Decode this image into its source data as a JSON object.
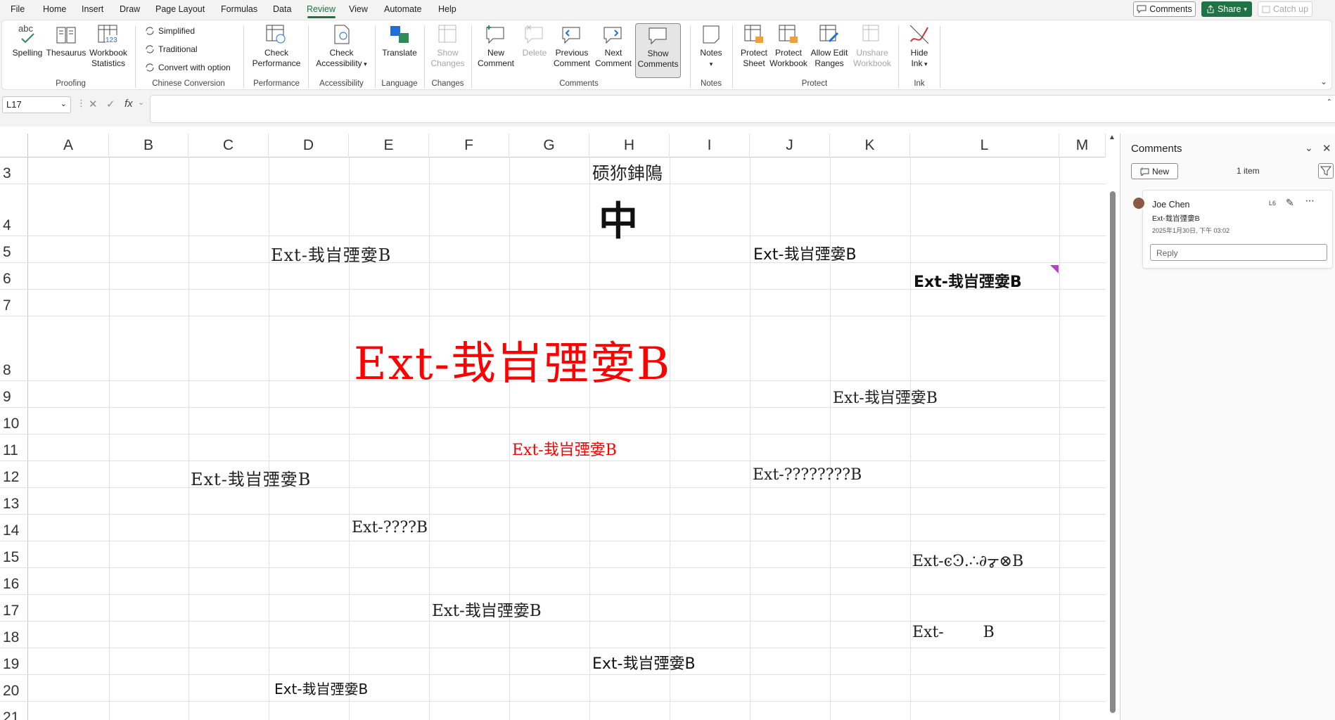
{
  "menubar": {
    "items": [
      "File",
      "Home",
      "Insert",
      "Draw",
      "Page Layout",
      "Formulas",
      "Data",
      "Review",
      "View",
      "Automate",
      "Help"
    ],
    "active": "Review",
    "comments_button": "Comments",
    "share_button": "Share",
    "catchup_button": "Catch up"
  },
  "ribbon": {
    "proofing": {
      "spelling": "Spelling",
      "thesaurus": "Thesaurus",
      "workbook_statistics_1": "Workbook",
      "workbook_statistics_2": "Statistics",
      "group": "Proofing",
      "abc": "abc",
      "num": "123"
    },
    "chinese": {
      "simplified": "Simplified",
      "traditional": "Traditional",
      "convert": "Convert with option",
      "group": "Chinese Conversion"
    },
    "performance": {
      "check_1": "Check",
      "check_2": "Performance",
      "group": "Performance"
    },
    "accessibility": {
      "check_1": "Check",
      "check_2": "Accessibility",
      "group": "Accessibility"
    },
    "language": {
      "translate": "Translate",
      "group": "Language"
    },
    "changes": {
      "show_1": "Show",
      "show_2": "Changes",
      "group": "Changes"
    },
    "comments": {
      "new_1": "New",
      "new_2": "Comment",
      "delete": "Delete",
      "previous_1": "Previous",
      "previous_2": "Comment",
      "next_1": "Next",
      "next_2": "Comment",
      "show_1": "Show",
      "show_2": "Comments",
      "group": "Comments"
    },
    "notes": {
      "notes": "Notes",
      "group": "Notes"
    },
    "protect": {
      "sheet_1": "Protect",
      "sheet_2": "Sheet",
      "workbook_1": "Protect",
      "workbook_2": "Workbook",
      "ranges_1": "Allow Edit",
      "ranges_2": "Ranges",
      "unshare_1": "Unshare",
      "unshare_2": "Workbook",
      "group": "Protect"
    },
    "ink": {
      "hide_1": "Hide",
      "hide_2": "Ink",
      "group": "Ink"
    }
  },
  "formula_bar": {
    "name_box": "L17",
    "fx": "fx",
    "value": ""
  },
  "grid": {
    "columns": [
      "A",
      "B",
      "C",
      "D",
      "E",
      "F",
      "G",
      "H",
      "I",
      "J",
      "K",
      "L",
      "M"
    ],
    "rows": [
      "3",
      "4",
      "5",
      "6",
      "7",
      "8",
      "9",
      "10",
      "11",
      "12",
      "13",
      "14",
      "15",
      "16",
      "17",
      "18",
      "19",
      "20",
      "21"
    ],
    "cells": {
      "H3": "䂵狝鋛隝",
      "H4": "中",
      "D5": "Ext-㘽㞱㢾㛳B",
      "J5": "Ext-㘽㞱㢾㛳B",
      "L6": "Ext-㘽㞱㢾㛳B",
      "E8": "Ext-㘽㞱㢾㛳B",
      "K9": "Ext-㘽㞱㢾㛳B",
      "G11": "Ext-㘽㞱㢾㛳B",
      "C12": "Ext-㘽㞱㢾㛳B",
      "J12": "Ext-????????B",
      "E14": "Ext-????B",
      "L15": "Ext-ͼϿ.∴∂ᡒ⊗B",
      "F17": "Ext-㘽㞱㢾㛳B",
      "L18": "Ext-        B",
      "H19": "Ext-㘽㞱㢾㛳B",
      "D20": "Ext-㘽㞱㢾㛳B"
    },
    "red_color": "#ff0000",
    "comment_marker_color": "#b146c2"
  },
  "comments_pane": {
    "title": "Comments",
    "new_button": "New",
    "count": "1 item",
    "comment": {
      "author": "Joe Chen",
      "cell": "L6",
      "text": "Ext-㘽㞱㢾㛳B",
      "timestamp": "2025年1月30日, 下午 03:02",
      "reply_placeholder": "Reply"
    }
  },
  "colors": {
    "accent": "#217346",
    "menubar_bg": "#f3f3f3"
  }
}
